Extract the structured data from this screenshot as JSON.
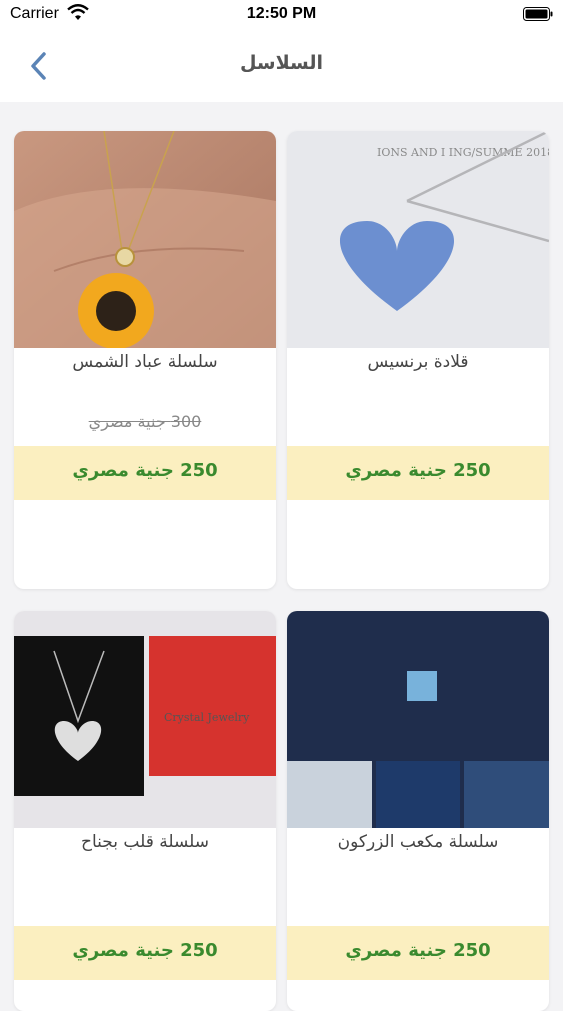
{
  "status_bar": {
    "carrier": "Carrier",
    "time": "12:50 PM"
  },
  "nav": {
    "title": "السلاسل",
    "back_icon": "chevron-left-icon"
  },
  "colors": {
    "price_band": "#fbefc0",
    "price_text": "#3a8a2e",
    "back_icon": "#5b84b6"
  },
  "products": [
    {
      "name": "سلسلة عباد الشمس",
      "old_price": "300 جنية مصري",
      "price": "250 جنية مصري",
      "image": "sunflower-necklace"
    },
    {
      "name": "قلادة برنسيس",
      "old_price": "",
      "price": "250 جنية مصري",
      "image": "princess-heart-necklace",
      "image_text": "IONS AND I ING/SUMME 2018"
    },
    {
      "name": "سلسلة قلب بجناح",
      "old_price": "",
      "price": "250 جنية مصري",
      "image": "winged-heart-necklace",
      "image_text": "Crystal Jewelry"
    },
    {
      "name": "سلسلة مكعب الزركون",
      "old_price": "",
      "price": "250 جنية مصري",
      "image": "zircon-cube-necklace"
    }
  ]
}
